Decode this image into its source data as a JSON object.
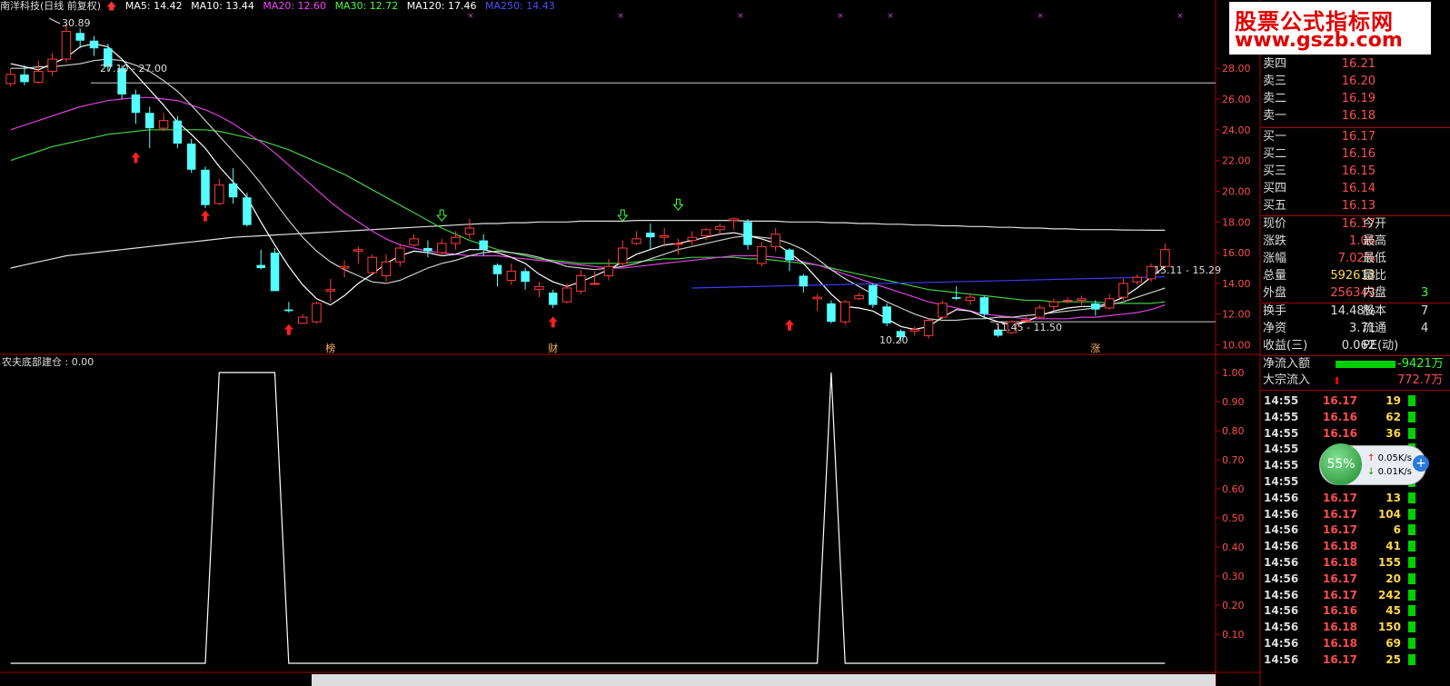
{
  "header": {
    "stock": "南洋科技(日线 前复权)",
    "ma": [
      {
        "label": "MA5: 14.42",
        "color": "#ffffff"
      },
      {
        "label": "MA10: 13.44",
        "color": "#ffffff"
      },
      {
        "label": "MA20: 12.60",
        "color": "#ff40ff"
      },
      {
        "label": "MA30: 12.72",
        "color": "#40ff40"
      },
      {
        "label": "MA120: 17.46",
        "color": "#ffffff"
      },
      {
        "label": "MA250: 14.43",
        "color": "#4040ff"
      }
    ]
  },
  "main_chart": {
    "ylim": [
      9.5,
      31.5
    ],
    "yticks": [
      "28.00",
      "26.00",
      "24.00",
      "22.00",
      "20.00",
      "18.00",
      "16.00",
      "14.00",
      "12.00",
      "10.00"
    ],
    "annotations": [
      "30.89",
      "27.10 - 27.00",
      "15.11 - 15.29",
      "11.45 - 11.50",
      "10.20"
    ],
    "markers": [
      "榜",
      "财",
      "涨"
    ]
  },
  "chart_data": {
    "type": "candlestick",
    "candles": [
      [
        27.0,
        27.6,
        28.0,
        26.8
      ],
      [
        27.6,
        27.1,
        28.2,
        26.9
      ],
      [
        27.1,
        27.8,
        28.5,
        27.0
      ],
      [
        27.8,
        28.6,
        29.0,
        27.5
      ],
      [
        28.6,
        30.4,
        30.9,
        28.4
      ],
      [
        30.3,
        29.8,
        30.6,
        29.3
      ],
      [
        29.8,
        29.3,
        30.1,
        28.8
      ],
      [
        29.3,
        28.1,
        29.6,
        27.8
      ],
      [
        28.0,
        26.3,
        28.2,
        26.0
      ],
      [
        26.3,
        25.1,
        26.6,
        24.4
      ],
      [
        25.1,
        24.1,
        25.5,
        22.8
      ],
      [
        24.1,
        24.6,
        25.1,
        23.9
      ],
      [
        24.6,
        23.1,
        24.9,
        22.8
      ],
      [
        23.1,
        21.4,
        23.4,
        21.2
      ],
      [
        21.4,
        19.1,
        21.6,
        18.9
      ],
      [
        19.2,
        20.4,
        20.8,
        19.1
      ],
      [
        20.5,
        19.6,
        21.5,
        19.2
      ],
      [
        19.6,
        17.8,
        19.9,
        17.7
      ],
      [
        15.2,
        15.0,
        16.2,
        14.9
      ],
      [
        16.0,
        13.5,
        16.3,
        13.5
      ],
      [
        12.3,
        12.2,
        12.8,
        12.1
      ],
      [
        11.4,
        11.8,
        12.0,
        11.4
      ],
      [
        11.5,
        12.7,
        12.8,
        11.4
      ],
      [
        13.5,
        13.6,
        14.3,
        12.8
      ],
      [
        15.0,
        15.1,
        15.5,
        14.4
      ],
      [
        16.1,
        16.2,
        16.4,
        15.3
      ],
      [
        14.7,
        15.7,
        15.9,
        14.6
      ],
      [
        14.5,
        15.4,
        15.9,
        14.1
      ],
      [
        15.4,
        16.3,
        16.6,
        15.1
      ],
      [
        16.5,
        16.9,
        17.2,
        16.4
      ],
      [
        16.3,
        16.1,
        16.8,
        15.7
      ],
      [
        16.0,
        16.6,
        16.9,
        15.8
      ],
      [
        16.6,
        17.0,
        17.4,
        16.2
      ],
      [
        17.2,
        17.6,
        18.2,
        16.9
      ],
      [
        16.8,
        16.2,
        17.2,
        15.8
      ],
      [
        15.2,
        14.6,
        15.3,
        13.8
      ],
      [
        14.2,
        14.8,
        15.3,
        13.9
      ],
      [
        14.8,
        14.1,
        15.0,
        13.6
      ],
      [
        13.6,
        13.8,
        14.1,
        13.1
      ],
      [
        13.4,
        12.6,
        13.6,
        12.4
      ],
      [
        12.8,
        13.7,
        14.0,
        12.7
      ],
      [
        13.5,
        14.5,
        14.9,
        13.3
      ],
      [
        14.0,
        14.0,
        14.8,
        13.9
      ],
      [
        14.5,
        15.1,
        15.6,
        14.2
      ],
      [
        15.3,
        16.3,
        16.8,
        15.1
      ],
      [
        16.6,
        16.9,
        17.4,
        16.5
      ],
      [
        17.3,
        17.0,
        17.9,
        16.2
      ],
      [
        17.0,
        17.1,
        17.6,
        16.4
      ],
      [
        16.6,
        16.6,
        16.9,
        15.9
      ],
      [
        16.8,
        17.0,
        17.4,
        16.5
      ],
      [
        17.1,
        17.5,
        17.6,
        16.8
      ],
      [
        17.5,
        17.7,
        17.9,
        17.2
      ],
      [
        18.1,
        18.2,
        18.3,
        17.5
      ],
      [
        18.0,
        16.5,
        18.2,
        16.2
      ],
      [
        15.3,
        16.4,
        16.7,
        15.1
      ],
      [
        16.4,
        17.2,
        17.6,
        16.1
      ],
      [
        16.2,
        15.5,
        16.3,
        14.8
      ],
      [
        14.5,
        13.8,
        14.6,
        13.4
      ],
      [
        13.0,
        13.1,
        13.3,
        12.2
      ],
      [
        12.7,
        11.5,
        12.9,
        11.4
      ],
      [
        11.5,
        12.8,
        12.9,
        11.3
      ],
      [
        13.0,
        13.2,
        13.4,
        12.9
      ],
      [
        13.9,
        12.6,
        14.0,
        12.4
      ],
      [
        12.5,
        11.4,
        12.7,
        11.2
      ],
      [
        10.9,
        10.5,
        11.0,
        10.2
      ],
      [
        10.9,
        11.0,
        11.2,
        10.6
      ],
      [
        10.6,
        11.6,
        11.7,
        10.4
      ],
      [
        11.8,
        12.7,
        12.9,
        11.7
      ],
      [
        13.1,
        13.0,
        13.8,
        12.9
      ],
      [
        12.9,
        13.1,
        13.3,
        12.6
      ],
      [
        13.1,
        12.0,
        13.2,
        11.7
      ],
      [
        11.0,
        10.6,
        11.2,
        10.5
      ],
      [
        10.8,
        11.5,
        11.6,
        10.7
      ],
      [
        11.6,
        11.6,
        11.9,
        11.4
      ],
      [
        11.8,
        12.4,
        12.6,
        11.7
      ],
      [
        12.5,
        12.8,
        13.0,
        12.2
      ],
      [
        12.9,
        12.9,
        13.1,
        12.7
      ],
      [
        12.9,
        13.0,
        13.2,
        12.6
      ],
      [
        12.7,
        12.3,
        12.9,
        11.9
      ],
      [
        12.4,
        13.0,
        13.3,
        12.3
      ],
      [
        13.1,
        14.0,
        14.3,
        12.9
      ],
      [
        14.1,
        14.4,
        14.6,
        13.9
      ],
      [
        14.3,
        15.1,
        15.3,
        14.1
      ],
      [
        15.1,
        16.2,
        16.6,
        15.0
      ]
    ],
    "ma5": [
      28.3,
      28.1,
      27.9,
      28.3,
      28.7,
      29.4,
      29.6,
      29.4,
      28.6,
      27.6,
      26.6,
      25.6,
      24.5,
      23.7,
      22.8,
      21.6,
      20.6,
      19.6,
      18.0,
      16.5,
      15.1,
      13.9,
      13.0,
      12.6,
      13.2,
      14.0,
      14.6,
      15.3,
      15.8,
      16.1,
      16.0,
      15.8,
      15.9,
      16.2,
      16.2,
      16.0,
      15.7,
      15.3,
      14.6,
      14.1,
      13.8,
      14.1,
      14.5,
      14.9,
      15.4,
      15.9,
      16.2,
      16.5,
      16.6,
      16.8,
      17.0,
      17.2,
      17.3,
      17.1,
      16.9,
      16.6,
      16.0,
      15.3,
      14.3,
      13.3,
      12.5,
      12.4,
      12.2,
      11.7,
      11.2,
      11.0,
      11.2,
      11.8,
      12.3,
      12.2,
      11.8,
      11.5,
      11.3,
      11.5,
      11.9,
      12.2,
      12.4,
      12.5,
      12.5,
      12.7,
      13.1,
      13.7,
      14.4,
      15.1
    ],
    "ma10": [
      28.0,
      28.0,
      28.1,
      28.1,
      28.2,
      28.3,
      28.5,
      28.6,
      28.5,
      28.2,
      27.8,
      27.2,
      26.5,
      25.6,
      24.6,
      23.6,
      22.6,
      21.6,
      20.5,
      19.3,
      18.1,
      17.0,
      16.1,
      15.4,
      14.9,
      14.5,
      14.1,
      14.0,
      14.2,
      14.6,
      15.0,
      15.3,
      15.5,
      15.8,
      16.0,
      16.1,
      16.0,
      15.9,
      15.7,
      15.4,
      15.1,
      15.0,
      14.9,
      15.0,
      15.1,
      15.3,
      15.6,
      15.9,
      16.2,
      16.4,
      16.6,
      16.8,
      17.0,
      17.1,
      17.0,
      16.9,
      16.6,
      16.2,
      15.6,
      14.9,
      14.3,
      13.8,
      13.3,
      12.8,
      12.4,
      12.0,
      11.7,
      11.6,
      11.6,
      11.7,
      11.7,
      11.8,
      11.8,
      11.9,
      12.0,
      12.1,
      12.2,
      12.3,
      12.4,
      12.6,
      12.8,
      13.1,
      13.4,
      13.7
    ],
    "ma20": [
      24.0,
      24.3,
      24.6,
      24.9,
      25.2,
      25.5,
      25.7,
      25.9,
      26.0,
      26.1,
      26.1,
      26.0,
      25.9,
      25.6,
      25.3,
      24.9,
      24.4,
      23.8,
      23.2,
      22.5,
      21.7,
      20.9,
      20.1,
      19.3,
      18.6,
      18.0,
      17.4,
      16.9,
      16.5,
      16.3,
      16.1,
      16.0,
      15.9,
      15.8,
      15.8,
      15.8,
      15.7,
      15.6,
      15.5,
      15.4,
      15.3,
      15.2,
      15.1,
      15.0,
      15.0,
      15.1,
      15.2,
      15.3,
      15.4,
      15.5,
      15.6,
      15.7,
      15.8,
      15.8,
      15.8,
      15.7,
      15.6,
      15.4,
      15.2,
      14.9,
      14.6,
      14.3,
      14.0,
      13.7,
      13.4,
      13.1,
      12.8,
      12.6,
      12.4,
      12.2,
      12.0,
      11.9,
      11.8,
      11.7,
      11.7,
      11.7,
      11.7,
      11.8,
      11.8,
      11.9,
      12.0,
      12.1,
      12.3,
      12.6
    ],
    "ma30": [
      22.0,
      22.3,
      22.6,
      22.9,
      23.1,
      23.3,
      23.5,
      23.7,
      23.8,
      23.9,
      24.0,
      24.0,
      24.0,
      24.0,
      24.0,
      23.9,
      23.7,
      23.5,
      23.3,
      23.0,
      22.7,
      22.3,
      21.9,
      21.5,
      21.1,
      20.6,
      20.1,
      19.6,
      19.1,
      18.6,
      18.1,
      17.6,
      17.2,
      16.8,
      16.5,
      16.2,
      16.0,
      15.8,
      15.6,
      15.5,
      15.4,
      15.3,
      15.3,
      15.3,
      15.3,
      15.4,
      15.5,
      15.6,
      15.6,
      15.7,
      15.7,
      15.7,
      15.7,
      15.6,
      15.6,
      15.5,
      15.4,
      15.3,
      15.2,
      15.0,
      14.8,
      14.6,
      14.4,
      14.2,
      14.0,
      13.8,
      13.6,
      13.5,
      13.4,
      13.3,
      13.2,
      13.1,
      13.0,
      12.9,
      12.9,
      12.8,
      12.8,
      12.8,
      12.8,
      12.7,
      12.7,
      12.7,
      12.7,
      12.8
    ],
    "ma120": [
      15.0,
      15.2,
      15.4,
      15.6,
      15.8,
      15.9,
      16.0,
      16.1,
      16.2,
      16.3,
      16.4,
      16.5,
      16.6,
      16.7,
      16.8,
      16.9,
      17.0,
      17.05,
      17.1,
      17.15,
      17.2,
      17.25,
      17.3,
      17.35,
      17.4,
      17.45,
      17.5,
      17.55,
      17.6,
      17.65,
      17.7,
      17.75,
      17.8,
      17.85,
      17.9,
      17.9,
      17.95,
      17.95,
      18.0,
      18.0,
      18.0,
      18.05,
      18.05,
      18.05,
      18.05,
      18.1,
      18.1,
      18.1,
      18.1,
      18.1,
      18.1,
      18.1,
      18.1,
      18.05,
      18.05,
      18.05,
      18.0,
      18.0,
      18.0,
      17.95,
      17.95,
      17.9,
      17.9,
      17.85,
      17.85,
      17.8,
      17.8,
      17.75,
      17.75,
      17.7,
      17.7,
      17.65,
      17.65,
      17.6,
      17.6,
      17.55,
      17.55,
      17.5,
      17.5,
      17.5,
      17.48,
      17.47,
      17.46,
      17.46
    ],
    "ma250": {
      "start_index": 49,
      "y0": 13.7,
      "y1": 14.43
    },
    "ind_title": "农夫底部建仓 : 0.00",
    "ind_ylim": [
      0,
      1
    ],
    "ind_yticks": [
      "1.00",
      "0.90",
      "0.80",
      "0.70",
      "0.60",
      "0.50",
      "0.40",
      "0.30",
      "0.20",
      "0.10"
    ],
    "indicator": [
      0,
      0,
      0,
      0,
      0,
      0,
      0,
      0,
      0,
      0,
      0,
      0,
      0,
      0,
      0,
      1,
      1,
      1,
      1,
      1,
      0,
      0,
      0,
      0,
      0,
      0,
      0,
      0,
      0,
      0,
      0,
      0,
      0,
      0,
      0,
      0,
      0,
      0,
      0,
      0,
      0,
      0,
      0,
      0,
      0,
      0,
      0,
      0,
      0,
      0,
      0,
      0,
      0,
      0,
      0,
      0,
      0,
      0,
      0,
      1,
      0,
      0,
      0,
      0,
      0,
      0,
      0,
      0,
      0,
      0,
      0,
      0,
      0,
      0,
      0,
      0,
      0,
      0,
      0,
      0,
      0,
      0,
      0,
      0
    ]
  },
  "quote_panel": {
    "asks": [
      {
        "label": "卖四",
        "price": "16.21"
      },
      {
        "label": "卖三",
        "price": "16.20"
      },
      {
        "label": "卖二",
        "price": "16.19"
      },
      {
        "label": "卖一",
        "price": "16.18"
      }
    ],
    "bids": [
      {
        "label": "买一",
        "price": "16.17"
      },
      {
        "label": "买二",
        "price": "16.16"
      },
      {
        "label": "买三",
        "price": "16.15"
      },
      {
        "label": "买四",
        "price": "16.14"
      },
      {
        "label": "买五",
        "price": "16.13"
      }
    ],
    "stats": [
      {
        "l1": "现价",
        "v1": "16.17",
        "l2": "今开",
        "v2": ""
      },
      {
        "l1": "涨跌",
        "v1": "1.06",
        "l2": "最高",
        "v2": ""
      },
      {
        "l1": "涨幅",
        "v1": "7.02%",
        "l2": "最低",
        "v2": ""
      },
      {
        "l1": "总量",
        "v1": "592613",
        "l2": "量比",
        "v2": ""
      },
      {
        "l1": "外盘",
        "v1": "256343",
        "l2": "内盘",
        "v2": "3"
      }
    ],
    "stats2": [
      {
        "l1": "换手",
        "v1": "14.48%",
        "l2": "股本",
        "v2": "7"
      },
      {
        "l1": "净资",
        "v1": "3.71",
        "l2": "流通",
        "v2": "4"
      },
      {
        "l1": "收益(三)",
        "v1": "0.062",
        "l2": "PE(动)",
        "v2": ""
      }
    ],
    "flow": [
      {
        "label": "净流入额",
        "value": "-9421万"
      },
      {
        "label": "大宗流入",
        "value": "772.7万"
      }
    ],
    "ticks": [
      {
        "t": "14:55",
        "p": "16.17",
        "v": "19"
      },
      {
        "t": "14:55",
        "p": "16.16",
        "v": "62"
      },
      {
        "t": "14:55",
        "p": "16.16",
        "v": "36"
      },
      {
        "t": "14:55",
        "p": "",
        "v": ""
      },
      {
        "t": "14:55",
        "p": "",
        "v": ""
      },
      {
        "t": "14:55",
        "p": "",
        "v": ""
      },
      {
        "t": "14:56",
        "p": "16.17",
        "v": "13"
      },
      {
        "t": "14:56",
        "p": "16.17",
        "v": "104"
      },
      {
        "t": "14:56",
        "p": "16.17",
        "v": "6"
      },
      {
        "t": "14:56",
        "p": "16.18",
        "v": "41"
      },
      {
        "t": "14:56",
        "p": "16.18",
        "v": "155"
      },
      {
        "t": "14:56",
        "p": "16.17",
        "v": "20"
      },
      {
        "t": "14:56",
        "p": "16.17",
        "v": "242"
      },
      {
        "t": "14:56",
        "p": "16.16",
        "v": "45"
      },
      {
        "t": "14:56",
        "p": "16.18",
        "v": "150"
      },
      {
        "t": "14:56",
        "p": "16.18",
        "v": "69"
      },
      {
        "t": "14:56",
        "p": "16.17",
        "v": "25"
      }
    ]
  },
  "logo": {
    "line1": "股票公式指标网",
    "line2": "www.gszb.com"
  },
  "speed": {
    "percent": "55%",
    "up": "0.05K/s",
    "down": "0.01K/s"
  }
}
